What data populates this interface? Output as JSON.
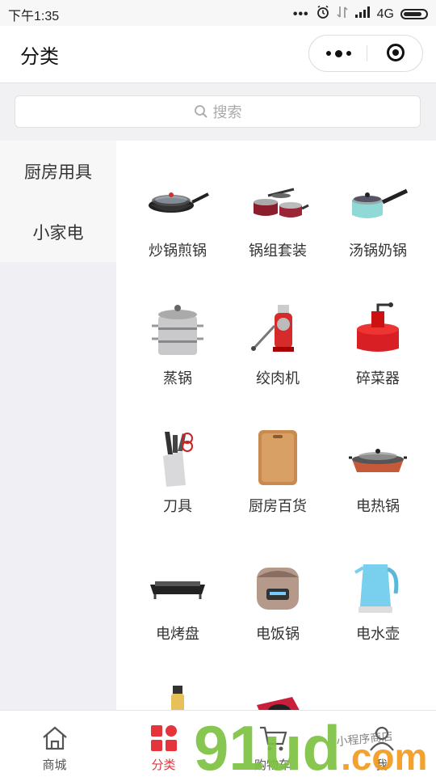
{
  "status": {
    "time": "下午1:35",
    "network": "4G"
  },
  "navbar": {
    "title": "分类"
  },
  "search": {
    "placeholder": "搜索"
  },
  "sidebar": {
    "items": [
      {
        "label": "厨房用具"
      },
      {
        "label": "小家电"
      }
    ]
  },
  "products": [
    {
      "label": "炒锅煎锅",
      "icon": "wok-icon"
    },
    {
      "label": "锅组套装",
      "icon": "pot-set-icon"
    },
    {
      "label": "汤锅奶锅",
      "icon": "saucepan-icon"
    },
    {
      "label": "蒸锅",
      "icon": "steamer-icon"
    },
    {
      "label": "绞肉机",
      "icon": "meat-grinder-icon"
    },
    {
      "label": "碎菜器",
      "icon": "chopper-icon"
    },
    {
      "label": "刀具",
      "icon": "knife-block-icon"
    },
    {
      "label": "厨房百货",
      "icon": "cutting-board-icon"
    },
    {
      "label": "电热锅",
      "icon": "electric-pot-icon"
    },
    {
      "label": "电烤盘",
      "icon": "grill-plate-icon"
    },
    {
      "label": "电饭锅",
      "icon": "rice-cooker-icon"
    },
    {
      "label": "电水壶",
      "icon": "kettle-icon"
    },
    {
      "label": "",
      "icon": "bottle-icon"
    },
    {
      "label": "",
      "icon": "hot-plate-icon"
    }
  ],
  "tabs": [
    {
      "label": "商城",
      "icon": "home-icon"
    },
    {
      "label": "分类",
      "icon": "category-icon"
    },
    {
      "label": "购物车",
      "icon": "cart-icon"
    },
    {
      "label": "我",
      "icon": "user-icon"
    }
  ],
  "watermark": {
    "text": "91ud.com",
    "script": "小程序商店"
  },
  "colors": {
    "accent": "#e5353b",
    "sidebar_bg": "#f0f0f4",
    "watermark_green": "#7dc242",
    "watermark_orange": "#f29a1e"
  }
}
